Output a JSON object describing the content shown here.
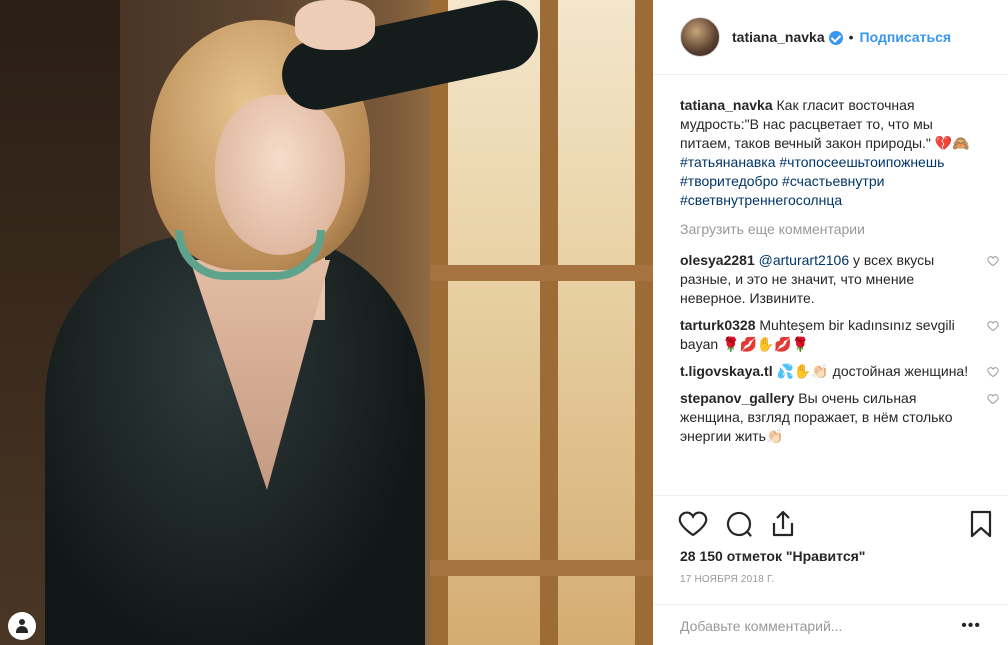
{
  "post": {
    "username": "tatiana_navka",
    "verified": true,
    "separator": "•",
    "follow_label": "Подписаться",
    "caption_text": "Как гласит восточная мудрость:\"В нас расцветает то, что мы питаем, таков вечный закон природы.\" 💔🙈",
    "hashtags": "#татьянанавка #чтопосеешьтоипожнешь #творитедобро #счастьевнутри #светвнутреннегосолнца",
    "load_more_label": "Загрузить еще комментарии"
  },
  "comments": [
    {
      "user": "olesya2281",
      "mention": "@arturart2106",
      "text": " у всех вкусы разные, и это не значит, что мнение неверное. Извините."
    },
    {
      "user": "tarturk0328",
      "mention": "",
      "text": "Muhteşem bir kadınsınız sevgili bayan 🌹💋✋💋🌹"
    },
    {
      "user": "t.ligovskaya.tl",
      "mention": "",
      "text": "💦✋👏🏻 достойная женщина!"
    },
    {
      "user": "stepanov_gallery",
      "mention": "",
      "text": "Вы очень сильная женщина, взгляд поражает, в нём столько энергии жить👏🏻"
    }
  ],
  "stats": {
    "likes_text": "28 150 отметок \"Нравится\"",
    "date_text": "17 НОЯБРЯ 2018 Г."
  },
  "composer": {
    "placeholder": "Добавьте комментарий...",
    "more_label": "•••"
  },
  "colors": {
    "accent": "#3897f0",
    "hashtag": "#003569",
    "muted": "#999999"
  },
  "icons": [
    "heart-icon",
    "comment-icon",
    "share-icon",
    "bookmark-icon",
    "user-icon"
  ]
}
